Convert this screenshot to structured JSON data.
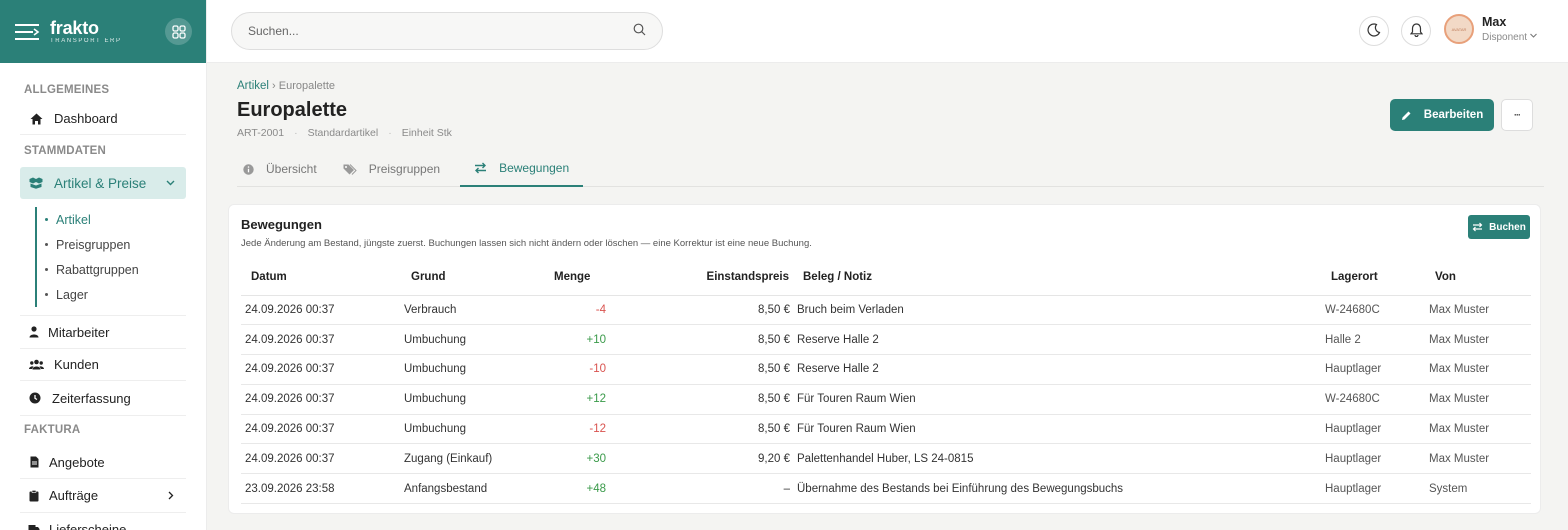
{
  "brand": {
    "name": "frakto",
    "subtitle": "TRANSPORT ERP"
  },
  "search": {
    "placeholder": "Suchen..."
  },
  "user": {
    "name": "Max",
    "role": "Disponent",
    "avatar_text": "AVATAR"
  },
  "sidebar": {
    "sections": {
      "general": "ALLGEMEINES",
      "master": "STAMMDATEN",
      "billing": "FAKTURA"
    },
    "dashboard": "Dashboard",
    "articles_prices": "Artikel & Preise",
    "subitems": [
      "Artikel",
      "Preisgruppen",
      "Rabattgruppen",
      "Lager"
    ],
    "employees": "Mitarbeiter",
    "customers": "Kunden",
    "time_tracking": "Zeiterfassung",
    "offers": "Angebote",
    "orders": "Aufträge",
    "deliveries": "Lieferscheine"
  },
  "breadcrumb": {
    "parent": "Artikel",
    "separator": "›",
    "current": "Europalette"
  },
  "page": {
    "title": "Europalette",
    "sku": "ART-2001",
    "type": "Standardartikel",
    "unit": "Einheit Stk",
    "separator": "·",
    "edit_label": "Bearbeiten",
    "more_label": "···"
  },
  "tabs": [
    "Übersicht",
    "Preisgruppen",
    "Bewegungen"
  ],
  "card": {
    "title": "Bewegungen",
    "subtitle": "Jede Änderung am Bestand, jüngste zuerst. Buchungen lassen sich nicht ändern oder löschen — eine Korrektur ist eine neue Buchung.",
    "book_label": "Buchen"
  },
  "table": {
    "headers": [
      "Datum",
      "Grund",
      "Menge",
      "Einstandspreis",
      "Beleg / Notiz",
      "Lagerort",
      "Von"
    ],
    "rows": [
      [
        "24.09.2026 00:37",
        "Verbrauch",
        "-4",
        "8,50 €",
        "Bruch beim Verladen",
        "W-24680C",
        "Max Muster"
      ],
      [
        "24.09.2026 00:37",
        "Umbuchung",
        "+10",
        "8,50 €",
        "Reserve Halle 2",
        "Halle 2",
        "Max Muster"
      ],
      [
        "24.09.2026 00:37",
        "Umbuchung",
        "-10",
        "8,50 €",
        "Reserve Halle 2",
        "Hauptlager",
        "Max Muster"
      ],
      [
        "24.09.2026 00:37",
        "Umbuchung",
        "+12",
        "8,50 €",
        "Für Touren Raum Wien",
        "W-24680C",
        "Max Muster"
      ],
      [
        "24.09.2026 00:37",
        "Umbuchung",
        "-12",
        "8,50 €",
        "Für Touren Raum Wien",
        "Hauptlager",
        "Max Muster"
      ],
      [
        "24.09.2026 00:37",
        "Zugang (Einkauf)",
        "+30",
        "9,20 €",
        "Palettenhandel Huber, LS 24-0815",
        "Hauptlager",
        "Max Muster"
      ],
      [
        "23.09.2026 23:58",
        "Anfangsbestand",
        "+48",
        "–",
        "Übernahme des Bestands bei Einführung des Bewegungsbuchs",
        "Hauptlager",
        "System"
      ]
    ]
  },
  "colors": {
    "accent": "#2b8078",
    "negative": "#d9534f",
    "positive": "#3a9a4a"
  }
}
